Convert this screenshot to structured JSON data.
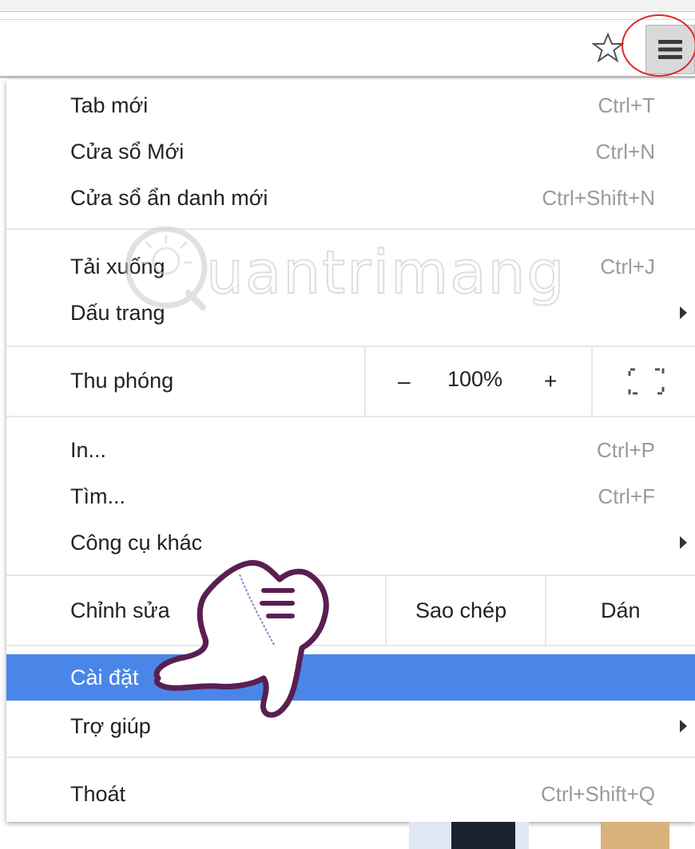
{
  "menu": {
    "items": [
      {
        "label": "Tab mới",
        "shortcut": "Ctrl+T"
      },
      {
        "label": "Cửa sổ Mới",
        "shortcut": "Ctrl+N"
      },
      {
        "label": "Cửa sổ ẩn danh mới",
        "shortcut": "Ctrl+Shift+N"
      },
      {
        "label": "Tải xuống",
        "shortcut": "Ctrl+J"
      },
      {
        "label": "Dấu trang",
        "shortcut": ""
      },
      {
        "label": "In...",
        "shortcut": "Ctrl+P"
      },
      {
        "label": "Tìm...",
        "shortcut": "Ctrl+F"
      },
      {
        "label": "Công cụ khác",
        "shortcut": ""
      },
      {
        "label": "Cài đặt",
        "shortcut": ""
      },
      {
        "label": "Trợ giúp",
        "shortcut": ""
      },
      {
        "label": "Thoát",
        "shortcut": "Ctrl+Shift+Q"
      }
    ],
    "zoom": {
      "label": "Thu phóng",
      "minus": "–",
      "value": "100%",
      "plus": "+"
    },
    "edit": {
      "label": "Chỉnh sửa",
      "copy": "Sao chép",
      "paste": "Dán"
    }
  },
  "watermark": {
    "text": "uantrimang"
  },
  "colors": {
    "highlight": "#4a86e8",
    "red_ring": "#e3262c",
    "hand_outline": "#5a1f52"
  }
}
